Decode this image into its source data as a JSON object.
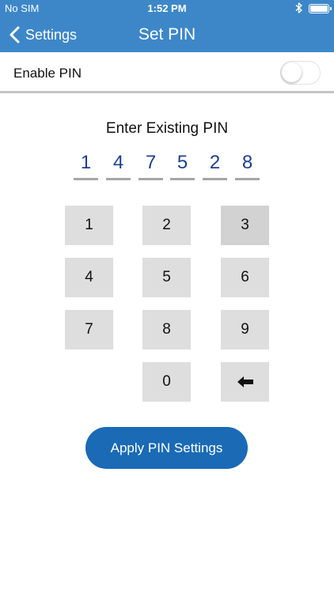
{
  "status_bar": {
    "carrier": "No SIM",
    "time": "1:52 PM"
  },
  "nav": {
    "back_label": "Settings",
    "title": "Set PIN"
  },
  "enable_pin": {
    "label": "Enable PIN",
    "enabled": false
  },
  "prompt": "Enter Existing PIN",
  "pin_digits": [
    "1",
    "4",
    "7",
    "5",
    "2",
    "8"
  ],
  "keypad": {
    "k1": "1",
    "k2": "2",
    "k3": "3",
    "k4": "4",
    "k5": "5",
    "k6": "6",
    "k7": "7",
    "k8": "8",
    "k9": "9",
    "k0": "0",
    "backspace_icon": "backspace-arrow-icon"
  },
  "apply_button": "Apply PIN Settings",
  "colors": {
    "nav_blue": "#3d87c9",
    "pin_digit_blue": "#1c3f94",
    "button_blue": "#1a6ab6",
    "key_gray": "#dedede"
  }
}
